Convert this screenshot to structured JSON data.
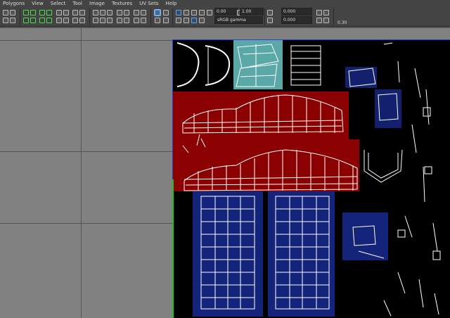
{
  "menu": [
    "Polygons",
    "View",
    "Select",
    "Tool",
    "Image",
    "Textures",
    "UV Sets",
    "Help"
  ],
  "toolbar": {
    "field1": "0.00",
    "field2": "1.00",
    "field3": "0.000",
    "field4": "0.000",
    "gamma": "sRGB gamma",
    "zoom": "0.30"
  },
  "colors": {
    "red_shell": "#8b0000",
    "blue_shell": "#14247a",
    "teal_shell": "#5aa9a8",
    "wire": "#ffffff"
  }
}
